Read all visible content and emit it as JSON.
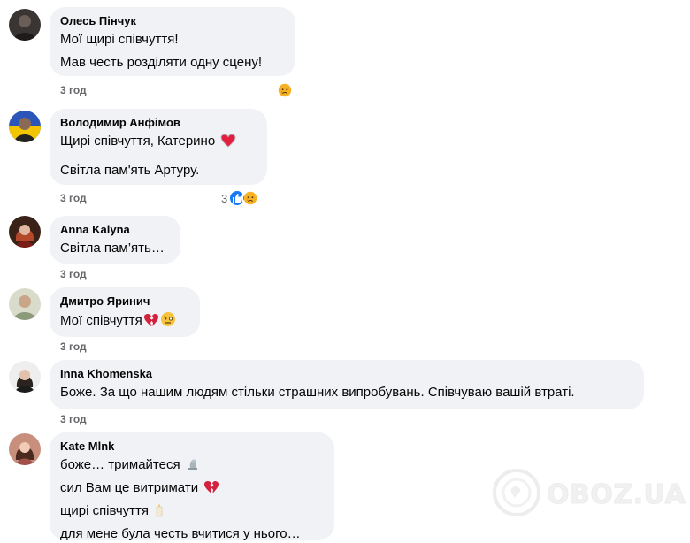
{
  "comments": [
    {
      "author": "Олесь Пінчук",
      "lines": [
        "Мої щирі співчуття!",
        "Мав честь розділяти одну сцену!"
      ],
      "time": "3 год",
      "reaction_count": "",
      "reactions": [
        "sad-reaction-icon"
      ]
    },
    {
      "author": "Володимир Анфімов",
      "lines": [
        "Щирі співчуття, Катерино",
        "Світла пам'ять Артуру."
      ],
      "time": "3 год",
      "reaction_count": "3",
      "reactions": [
        "like-reaction-icon",
        "sad-reaction-icon"
      ]
    },
    {
      "author": "Anna Kalyna",
      "lines": [
        "Світла пам’ять…"
      ],
      "time": "3 год"
    },
    {
      "author": "Дмитро Яринич",
      "lines": [
        "Мої співчуття"
      ],
      "time": "3 год"
    },
    {
      "author": "Inna Khomenska",
      "lines": [
        "Боже. За що нашим людям стільки страшних випробувань. Співчуваю вашій втраті."
      ],
      "time": "3 год"
    },
    {
      "author": "Kate Mlnk",
      "lines": [
        "боже… тримайтеся",
        "сил Вам це витримати",
        "щирі співчуття",
        "для мене була честь вчитися у нього…"
      ]
    }
  ],
  "watermark": "OBOZ.UA",
  "colors": {
    "bubble": "#f0f2f5",
    "meta": "#65676b",
    "like": "#1877f2",
    "sad": "#f7b125",
    "heart": "#e41e3f"
  }
}
